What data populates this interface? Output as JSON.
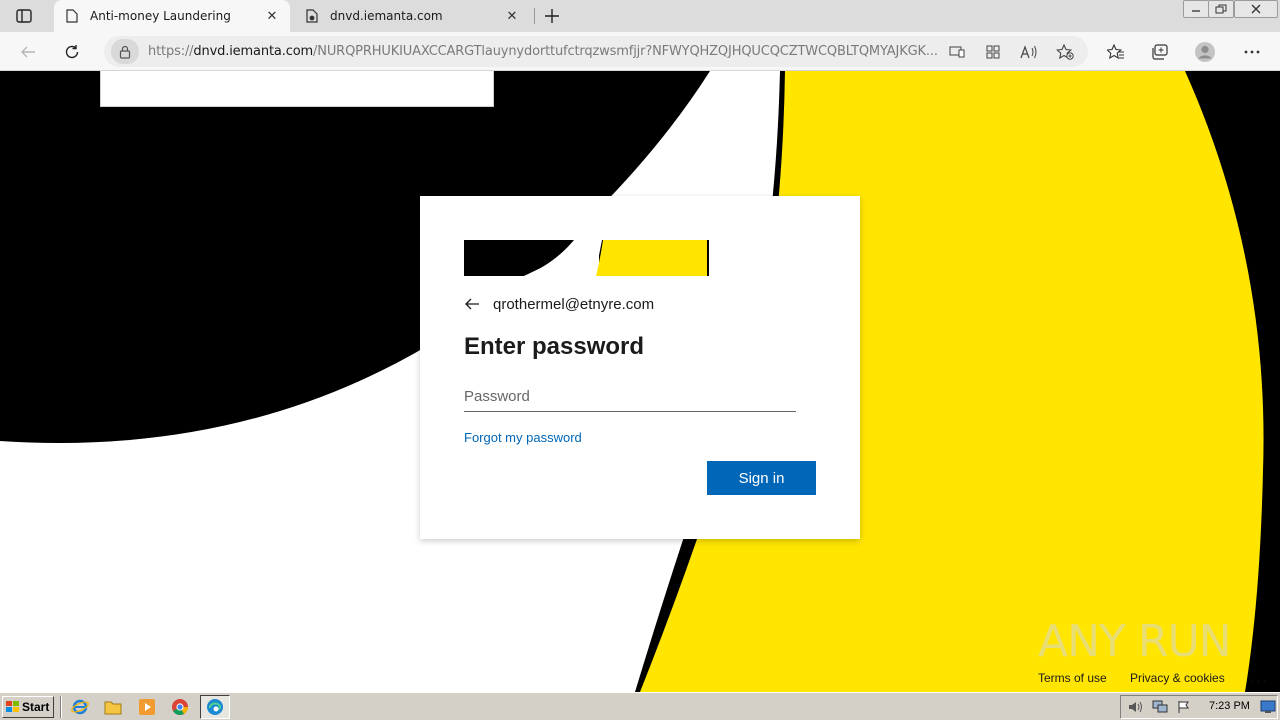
{
  "browser": {
    "tabs": [
      {
        "title": "Anti-money Laundering",
        "active": true
      },
      {
        "title": "dnvd.iemanta.com",
        "active": false
      }
    ],
    "address": {
      "scheme": "https://",
      "host": "dnvd.iemanta.com",
      "path": "/NURQPRHUKIUAXCCARGTlauynydorttufctrqzwsmfjjr?NFWYQHZQJHQUCQCZTWCQBLTQMYAJKGK..."
    }
  },
  "login": {
    "email": "qrothermel@etnyre.com",
    "title": "Enter password",
    "password_placeholder": "Password",
    "forgot_label": "Forgot my password",
    "signin_label": "Sign in"
  },
  "footer": {
    "terms": "Terms of use",
    "privacy": "Privacy & cookies",
    "more": ". . ."
  },
  "watermark": "ANY RUN",
  "taskbar": {
    "start_label": "Start",
    "clock": "7:23 PM",
    "quicklaunch_icons": [
      "ie-icon",
      "folder-icon",
      "media-player-icon",
      "chrome-icon"
    ],
    "active_task_icon": "edge-icon"
  },
  "colors": {
    "accent": "#0067b8",
    "yellow": "#ffe500",
    "black": "#000000"
  }
}
